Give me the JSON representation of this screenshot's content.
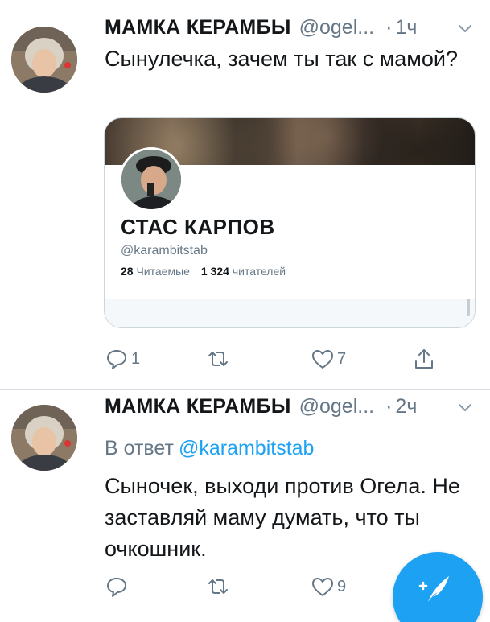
{
  "tweets": [
    {
      "author_name": "МАМКА КЕРАМБЫ",
      "author_handle": "@ogel...",
      "dot": "·",
      "time": "1ч",
      "text": "Сынулечка, зачем ты так с мамой?",
      "card": {
        "name": "СТАС КАРПОВ",
        "handle": "@karambitstab",
        "following_count": "28",
        "following_label": "Читаемые",
        "followers_count": "1 324",
        "followers_label": "читателей"
      },
      "actions": {
        "reply_count": "1",
        "retweet_count": "",
        "like_count": "7"
      }
    },
    {
      "author_name": "МАМКА КЕРАМБЫ",
      "author_handle": "@ogel...",
      "dot": "·",
      "time": "2ч",
      "reply_prefix": "В ответ",
      "reply_mention": "@karambitstab",
      "text": "Сыночек, выходи против Огела. Не заставляй маму думать, что ты очкошник.",
      "actions": {
        "reply_count": "",
        "retweet_count": "",
        "like_count": "9"
      }
    }
  ],
  "colors": {
    "accent": "#1da1f2",
    "secondary_text": "#657786",
    "border": "#ccd6dd"
  },
  "icons": [
    "reply-icon",
    "retweet-icon",
    "like-icon",
    "share-icon",
    "chevron-down-icon",
    "compose-icon"
  ]
}
